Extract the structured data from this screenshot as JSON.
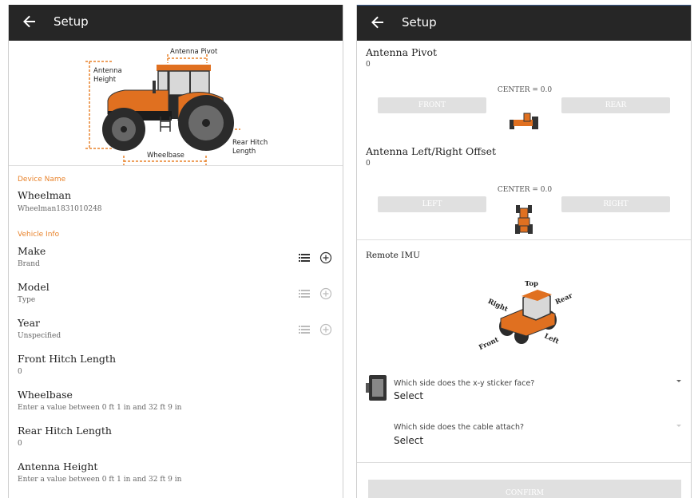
{
  "left": {
    "app_title": "Setup",
    "diagram": {
      "antenna_pivot": "Antenna Pivot",
      "antenna_height_1": "Antenna",
      "antenna_height_2": "Height",
      "rear_hitch_1": "Rear Hitch",
      "rear_hitch_2": "Length",
      "wheelbase": "Wheelbase"
    },
    "device_section": "Device Name",
    "device_name": "Wheelman",
    "device_id": "Wheelman1831010248",
    "vehicle_section": "Vehicle Info",
    "rows": [
      {
        "title": "Make",
        "sub": "Brand"
      },
      {
        "title": "Model",
        "sub": "Type"
      },
      {
        "title": "Year",
        "sub": "Unspecified"
      },
      {
        "title": "Front Hitch Length",
        "sub": "0"
      },
      {
        "title": "Wheelbase",
        "sub": "Enter a value between 0 ft 1 in and 32 ft 9 in"
      },
      {
        "title": "Rear Hitch Length",
        "sub": "0"
      },
      {
        "title": "Antenna Height",
        "sub": "Enter a value between 0 ft 1 in and 32 ft 9 in"
      }
    ]
  },
  "right": {
    "app_title": "Setup",
    "pivot_title": "Antenna Pivot",
    "pivot_value": "0",
    "pivot_center": "CENTER = 0.0",
    "front_btn": "FRONT",
    "rear_btn": "REAR",
    "offset_title": "Antenna Left/Right Offset",
    "offset_value": "0",
    "offset_center": "CENTER = 0.0",
    "left_btn": "LEFT",
    "right_btn": "RIGHT",
    "imu_title": "Remote IMU",
    "imu_labels": {
      "top": "Top",
      "rear": "Rear",
      "right": "Right",
      "left": "Left",
      "front": "Front"
    },
    "q1": "Which side does the x-y sticker face?",
    "q1_value": "Select",
    "q2": "Which side does the cable attach?",
    "q2_value": "Select",
    "confirm": "CONFIRM"
  },
  "colors": {
    "accent": "#e8822a",
    "appbar": "#262626",
    "disabled": "#e0e0e0"
  }
}
